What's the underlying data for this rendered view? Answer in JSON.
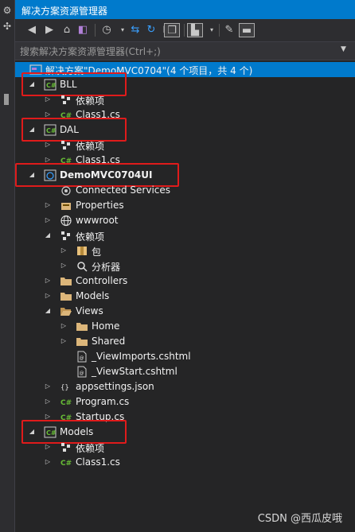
{
  "window": {
    "title": "解决方案资源管理器"
  },
  "search": {
    "placeholder": "搜索解决方案资源管理器(Ctrl+;)"
  },
  "tree": [
    {
      "label": "解决方案\"DemoMVC0704\"(4 个项目，共 4 个)",
      "icon": "solution-icon",
      "level": 0,
      "expander": "none",
      "root": true
    },
    {
      "label": "BLL",
      "icon": "csharp-project-icon",
      "level": 1,
      "expander": "expanded",
      "highlight": true
    },
    {
      "label": "依赖项",
      "icon": "dependencies-icon",
      "level": 2,
      "expander": "collapsed"
    },
    {
      "label": "Class1.cs",
      "icon": "csharp-file-icon",
      "level": 2,
      "expander": "collapsed"
    },
    {
      "label": "DAL",
      "icon": "csharp-project-icon",
      "level": 1,
      "expander": "expanded",
      "highlight": true
    },
    {
      "label": "依赖项",
      "icon": "dependencies-icon",
      "level": 2,
      "expander": "collapsed"
    },
    {
      "label": "Class1.cs",
      "icon": "csharp-file-icon",
      "level": 2,
      "expander": "collapsed"
    },
    {
      "label": "DemoMVC0704UI",
      "icon": "web-project-icon",
      "level": 1,
      "expander": "expanded",
      "bold": true,
      "highlight": true
    },
    {
      "label": "Connected Services",
      "icon": "connected-services-icon",
      "level": 2,
      "expander": "none"
    },
    {
      "label": "Properties",
      "icon": "properties-icon",
      "level": 2,
      "expander": "collapsed"
    },
    {
      "label": "wwwroot",
      "icon": "globe-icon",
      "level": 2,
      "expander": "collapsed"
    },
    {
      "label": "依赖项",
      "icon": "dependencies-icon",
      "level": 2,
      "expander": "expanded"
    },
    {
      "label": "包",
      "icon": "package-icon",
      "level": 3,
      "expander": "collapsed"
    },
    {
      "label": "分析器",
      "icon": "analyzer-icon",
      "level": 3,
      "expander": "collapsed"
    },
    {
      "label": "Controllers",
      "icon": "folder-icon",
      "level": 2,
      "expander": "collapsed"
    },
    {
      "label": "Models",
      "icon": "folder-icon",
      "level": 2,
      "expander": "collapsed"
    },
    {
      "label": "Views",
      "icon": "folder-open-icon",
      "level": 2,
      "expander": "expanded"
    },
    {
      "label": "Home",
      "icon": "folder-icon",
      "level": 3,
      "expander": "collapsed"
    },
    {
      "label": "Shared",
      "icon": "folder-icon",
      "level": 3,
      "expander": "collapsed"
    },
    {
      "label": "_ViewImports.cshtml",
      "icon": "razor-file-icon",
      "level": 3,
      "expander": "none"
    },
    {
      "label": "_ViewStart.cshtml",
      "icon": "razor-file-icon",
      "level": 3,
      "expander": "none"
    },
    {
      "label": "appsettings.json",
      "icon": "json-file-icon",
      "level": 2,
      "expander": "collapsed"
    },
    {
      "label": "Program.cs",
      "icon": "csharp-file-icon",
      "level": 2,
      "expander": "collapsed"
    },
    {
      "label": "Startup.cs",
      "icon": "csharp-file-icon",
      "level": 2,
      "expander": "collapsed"
    },
    {
      "label": "Models",
      "icon": "csharp-project-icon",
      "level": 1,
      "expander": "expanded",
      "highlight": true
    },
    {
      "label": "依赖项",
      "icon": "dependencies-icon",
      "level": 2,
      "expander": "collapsed"
    },
    {
      "label": "Class1.cs",
      "icon": "csharp-file-icon",
      "level": 2,
      "expander": "collapsed"
    }
  ],
  "watermark": "CSDN @西瓜皮哦",
  "colors": {
    "accent": "#007acc",
    "background": "#252526",
    "highlight_box": "#e01b1b"
  }
}
